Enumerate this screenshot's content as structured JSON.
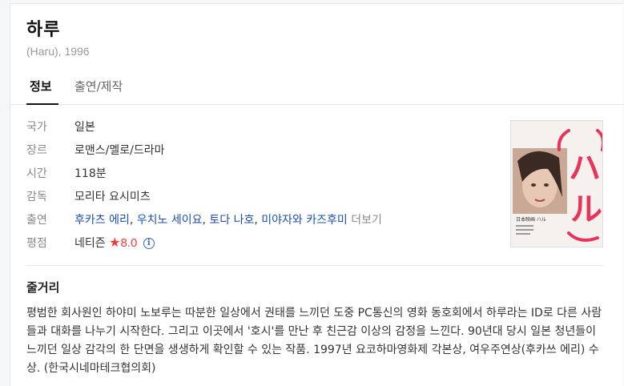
{
  "movie": {
    "title": "하루",
    "subtitle": "(Haru), 1996"
  },
  "tabs": [
    {
      "label": "정보",
      "active": true
    },
    {
      "label": "출연/제작",
      "active": false
    }
  ],
  "info": {
    "country_label": "국가",
    "country_value": "일본",
    "genre_label": "장르",
    "genre_value": "로맨스/멜로/드라마",
    "runtime_label": "시간",
    "runtime_value": "118분",
    "director_label": "감독",
    "director_value": "모리타 요시미츠",
    "cast_label": "출연",
    "cast": [
      "후카츠 에리",
      "우치노 세이요",
      "토다 나호",
      "미야자와 카즈후미"
    ],
    "cast_more": "더보기",
    "rating_label": "평점",
    "rating_source": "네티즌",
    "rating_star": "★",
    "rating_value": "8.0",
    "rating_info": "i"
  },
  "poster": {
    "katakana": "ハル",
    "side_text": "日本映画 ハル"
  },
  "plot": {
    "title": "줄거리",
    "text": "평범한 회사원인 하야미 노보루는 따분한 일상에서 권태를 느끼던 도중 PC통신의 영화 동호회에서 하루라는 ID로 다른 사람들과 대화를 나누기 시작한다. 그리고 이곳에서 '호시'를 만난 후 친근감 이상의 감정을 느낀다. 90년대 당시 일본 청년들이 느끼던 일상 감각의 한 단면을 생생하게 확인할 수 있는 작품. 1997년 요코하마영화제 각본상, 여우주연상(후카쓰 에리) 수상. (한국시네마테크협의회)"
  },
  "colors": {
    "link": "#1c4fb4",
    "rating": "#ef3b3b",
    "poster_accent": "#e8335a"
  }
}
